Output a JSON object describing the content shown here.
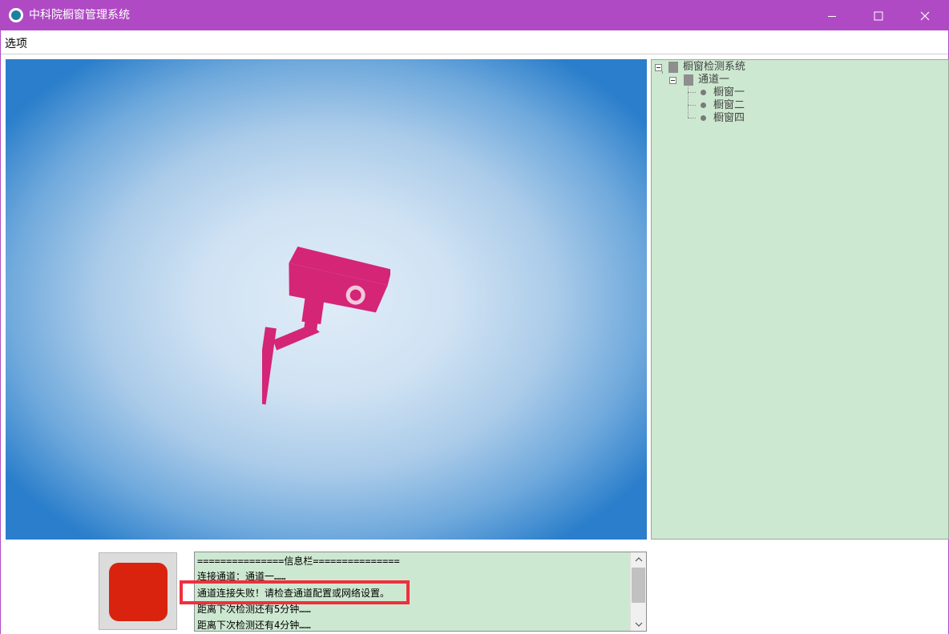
{
  "window": {
    "title": "中科院橱窗管理系统",
    "title_bar_color": "#b04ac4",
    "app_icon": "app-logo-icon",
    "controls": [
      "minimize-icon",
      "maximize-icon",
      "close-icon"
    ]
  },
  "menu": {
    "items": [
      {
        "label": "选项"
      }
    ]
  },
  "video": {
    "placeholder_icon": "security-camera-icon",
    "icon_color": "#d42577"
  },
  "tree": {
    "background": "#cde8d0",
    "root": {
      "label": "橱窗检测系统",
      "expanded": true
    },
    "channel": {
      "label": "通道一",
      "expanded": true
    },
    "windows": [
      {
        "label": "橱窗一"
      },
      {
        "label": "橱窗二"
      },
      {
        "label": "橱窗四"
      }
    ]
  },
  "status_indicator": {
    "color": "#d9230e"
  },
  "info_log": {
    "lines": [
      "===============信息栏===============",
      "连接通道：通道一……",
      "通道连接失败！请检查通道配置或网络设置。",
      "距离下次检测还有5分钟……",
      "距离下次检测还有4分钟……"
    ],
    "highlight_color": "#ef2f3e"
  }
}
